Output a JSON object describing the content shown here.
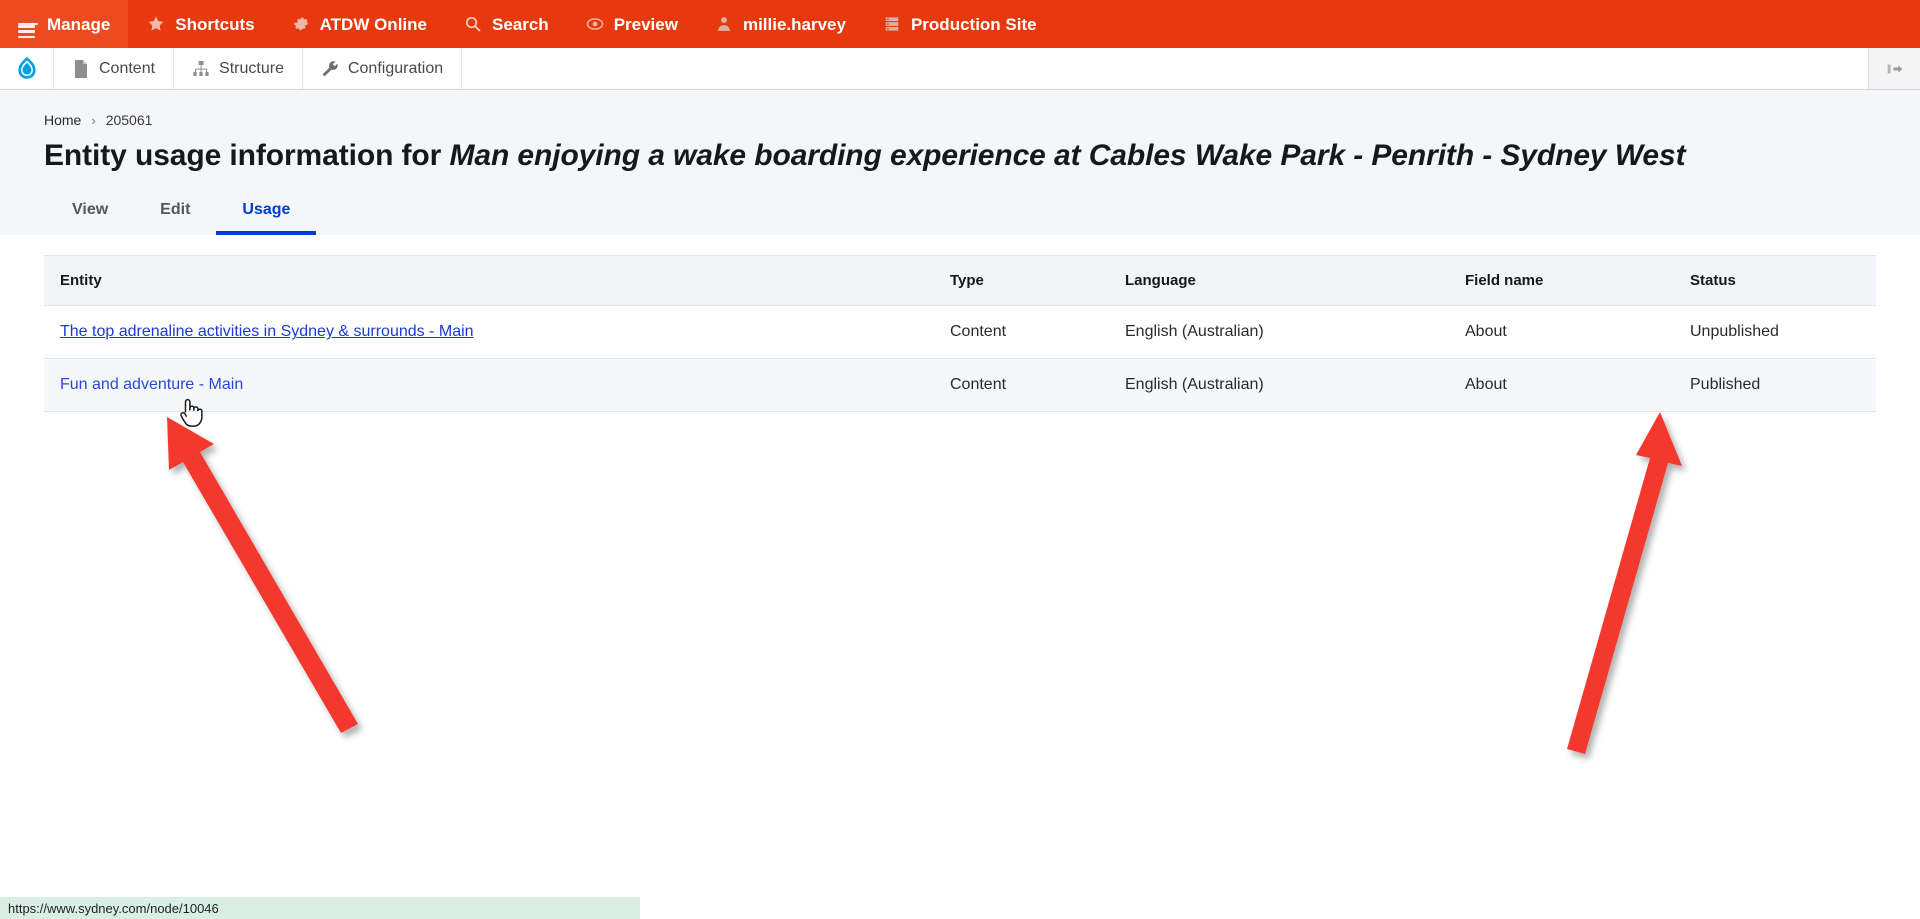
{
  "toolbar": {
    "items": [
      {
        "label": "Manage",
        "icon": "hamburger-icon",
        "active": true
      },
      {
        "label": "Shortcuts",
        "icon": "star-icon",
        "active": false
      },
      {
        "label": "ATDW Online",
        "icon": "gear-icon",
        "active": false
      },
      {
        "label": "Search",
        "icon": "search-icon",
        "active": false
      },
      {
        "label": "Preview",
        "icon": "eye-icon",
        "active": false
      },
      {
        "label": "millie.harvey",
        "icon": "user-icon",
        "active": false
      },
      {
        "label": "Production Site",
        "icon": "server-icon",
        "active": false
      }
    ],
    "background_color": "#e8380d",
    "active_color": "#ec4a20"
  },
  "tray": {
    "logo": "drupal-droplet-icon",
    "items": [
      {
        "label": "Content",
        "icon": "file-icon"
      },
      {
        "label": "Structure",
        "icon": "hierarchy-icon"
      },
      {
        "label": "Configuration",
        "icon": "wrench-icon"
      }
    ],
    "collapse": {
      "icon": "collapse-sidebar-icon",
      "label": ""
    }
  },
  "breadcrumb": {
    "items": [
      {
        "label": "Home",
        "link": true
      },
      {
        "label": "205061",
        "link": false
      }
    ],
    "separator": "›"
  },
  "page": {
    "title_prefix": "Entity usage information for",
    "title_emphasis": "Man enjoying a wake boarding experience at Cables Wake Park - Penrith - Sydney West"
  },
  "tabs": [
    {
      "label": "View",
      "active": false
    },
    {
      "label": "Edit",
      "active": false
    },
    {
      "label": "Usage",
      "active": true
    }
  ],
  "table": {
    "headers": [
      "Entity",
      "Type",
      "Language",
      "Field name",
      "Status"
    ],
    "rows": [
      {
        "entity": "The top adrenaline activities in Sydney & surrounds - Main",
        "entity_is_link": true,
        "entity_visited": false,
        "type": "Content",
        "language": "English (Australian)",
        "field_name": "About",
        "status": "Unpublished"
      },
      {
        "entity": "Fun and adventure - Main",
        "entity_is_link": true,
        "entity_visited": true,
        "type": "Content",
        "language": "English (Australian)",
        "field_name": "About",
        "status": "Published"
      }
    ]
  },
  "status_bar": {
    "url": "https://www.sydney.com/node/10046"
  },
  "annotations": {
    "arrow_color": "#f5382e",
    "arrows": [
      {
        "name": "arrow-to-entity-link",
        "points_to": "Fun and adventure - Main"
      },
      {
        "name": "arrow-to-status",
        "points_to": "Published"
      }
    ]
  },
  "colors": {
    "toolbar_red": "#e8380d",
    "tab_active_blue": "#003ecc",
    "link_blue": "#1a3ad6",
    "header_bg": "#f5f6fa",
    "row_alt_bg": "#f6f7fb",
    "status_bar_bg": "#d9efe6"
  }
}
